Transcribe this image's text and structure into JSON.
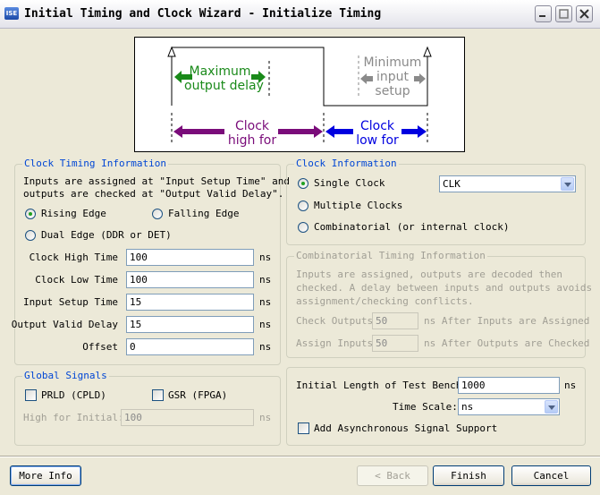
{
  "window": {
    "title": "Initial Timing and Clock Wizard - Initialize Timing",
    "icon": "ISE"
  },
  "diagram": {
    "max_output_delay": [
      "Maximum",
      "output delay"
    ],
    "min_input_setup": [
      "Minimum",
      "input",
      "setup"
    ],
    "clock_high": [
      "Clock",
      "high for"
    ],
    "clock_low": [
      "Clock",
      "low for"
    ],
    "colors": {
      "green": "#1a8a1a",
      "gray": "#8a8a8a",
      "purple": "#7a0c7a",
      "blue": "#0000e0"
    }
  },
  "clock_timing": {
    "legend": "Clock Timing Information",
    "description": [
      "Inputs are assigned at \"Input Setup Time\" and",
      "outputs are checked at \"Output Valid Delay\"."
    ],
    "rising_edge": "Rising Edge",
    "falling_edge": "Falling Edge",
    "dual_edge": "Dual Edge (DDR or DET)",
    "clock_high_label": "Clock High Time",
    "clock_high_value": "100",
    "clock_low_label": "Clock Low Time",
    "clock_low_value": "100",
    "input_setup_label": "Input Setup Time",
    "input_setup_value": "15",
    "output_valid_label": "Output Valid Delay",
    "output_valid_value": "15",
    "offset_label": "Offset",
    "offset_value": "0",
    "unit": "ns"
  },
  "clock_info": {
    "legend": "Clock Information",
    "single_clock": "Single Clock",
    "multiple_clocks": "Multiple Clocks",
    "combinatorial": "Combinatorial (or internal clock)",
    "clock_select": "CLK"
  },
  "comb_timing": {
    "legend": "Combinatorial Timing Information",
    "description": [
      "Inputs are assigned, outputs are decoded then",
      "checked.  A delay between inputs and outputs avoids",
      "assignment/checking conflicts."
    ],
    "check_outputs_label": "Check Outputs",
    "check_outputs_value": "50",
    "check_outputs_suffix": "ns After Inputs are Assigned",
    "assign_inputs_label": "Assign Inputs",
    "assign_inputs_value": "50",
    "assign_inputs_suffix": "ns After Outputs are Checked"
  },
  "global_signals": {
    "legend": "Global Signals",
    "prld": "PRLD (CPLD)",
    "gsr": "GSR (FPGA)",
    "high_for_initial_label": "High for Initial:",
    "high_for_initial_value": "100",
    "unit": "ns"
  },
  "test_bench": {
    "length_label": "Initial Length of Test Bench:",
    "length_value": "1000",
    "length_unit": "ns",
    "time_scale_label": "Time Scale:",
    "time_scale_value": "ns",
    "async_label": "Add Asynchronous Signal Support"
  },
  "buttons": {
    "more_info": "More Info",
    "back": "< Back",
    "finish": "Finish",
    "cancel": "Cancel"
  }
}
